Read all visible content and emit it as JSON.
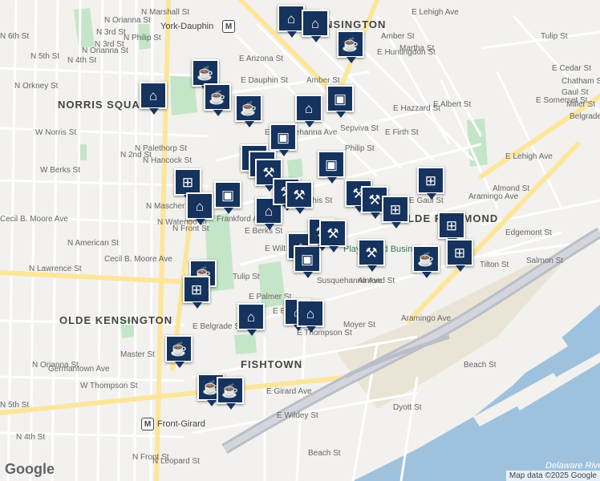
{
  "map": {
    "attribution": "Map data ©2025 Google",
    "logo": "Google",
    "river_label": "Delaware River",
    "colors": {
      "water": "#9ec2de",
      "park": "#c5e5c8",
      "road_major": "#fde69a",
      "highway": "#b9bec7",
      "land": "#f2f1ee",
      "marker": "#16335e"
    }
  },
  "neighborhoods": [
    {
      "name": "NORRIS SQUARE"
    },
    {
      "name": "OLDE KENSINGTON"
    },
    {
      "name": "FISHTOWN"
    },
    {
      "name": "OLDE RICHMOND"
    },
    {
      "name": "KENSINGTON"
    }
  ],
  "places": [
    {
      "name": "Playground Business"
    },
    {
      "name": "York-Dauphin"
    },
    {
      "name": "Front-Girard"
    }
  ],
  "streets": [
    "N 6th St",
    "N 5th St",
    "N 4th St",
    "N Orianna St",
    "N 3rd St",
    "N Philip St",
    "N 2nd St",
    "N Palethorp St",
    "N Hancock St",
    "N Orkney St",
    "W Norris St",
    "W Berks St",
    "Cecil B. Moore Ave",
    "Cecil B. Moore Ave",
    "N American St",
    "N Mascher St",
    "N Waterloo St",
    "N Front St",
    "Frankford Ave",
    "N Lawrence St",
    "N Orianna St",
    "Germantown Ave",
    "W Thompson St",
    "Master St",
    "N 5th St",
    "N 4th St",
    "N Front St",
    "N Leopard St",
    "E Girard Ave",
    "E Wildey St",
    "Beach St",
    "Dyott St",
    "Beach St",
    "Aramingo Ave",
    "Almond St",
    "Moyer St",
    "E Thompson St",
    "Tilton St",
    "Salmon St",
    "Edgemont St",
    "E Belgrade St",
    "E Eyre St",
    "Tulip St",
    "E Palmer St",
    "E Berks St",
    "E Wilt St",
    "Susquehanna Ave",
    "E Memphis St",
    "Sepviva St",
    "Philip St",
    "E Firth St",
    "E Hazzard St",
    "E Albert St",
    "E Huntingdon St",
    "Amber St",
    "Martha St",
    "E Lehigh Ave",
    "E Dauphin St",
    "E Arizona St",
    "Amber St",
    "Tulip St",
    "E Cedar St",
    "Chatham St",
    "Gaul St",
    "Miller St",
    "E Somerset St",
    "Belgrade St",
    "E Lehigh Ave",
    "Almond St",
    "Aramingo Ave",
    "E Gaul St",
    "E Susquehanna Ave",
    "N Orianna St",
    "N Marshall St",
    "N 3rd St"
  ],
  "markers": [
    {
      "icon": "graduation-cap-icon"
    },
    {
      "icon": "graduation-cap-icon"
    },
    {
      "icon": "coffee-icon"
    },
    {
      "icon": "coffee-icon"
    },
    {
      "icon": "graduation-cap-icon"
    },
    {
      "icon": "coffee-icon"
    },
    {
      "icon": "coffee-icon"
    },
    {
      "icon": "shopping-bag-icon"
    },
    {
      "icon": "graduation-cap-icon"
    },
    {
      "icon": "shopping-bag-icon"
    },
    {
      "icon": "restaurant-icon"
    },
    {
      "icon": "restaurant-icon"
    },
    {
      "icon": "restaurant-icon"
    },
    {
      "icon": "shopping-cart-icon"
    },
    {
      "icon": "graduation-cap-icon"
    },
    {
      "icon": "shopping-bag-icon"
    },
    {
      "icon": "shopping-bag-icon"
    },
    {
      "icon": "graduation-cap-icon"
    },
    {
      "icon": "shopping-cart-icon"
    },
    {
      "icon": "restaurant-icon"
    },
    {
      "icon": "restaurant-icon"
    },
    {
      "icon": "restaurant-icon"
    },
    {
      "icon": "restaurant-icon"
    },
    {
      "icon": "shopping-cart-icon"
    },
    {
      "icon": "graduation-cap-icon"
    },
    {
      "icon": "shopping-bag-icon"
    },
    {
      "icon": "shopping-cart-icon"
    },
    {
      "icon": "coffee-icon"
    },
    {
      "icon": "graduation-cap-icon"
    },
    {
      "icon": "restaurant-icon"
    },
    {
      "icon": "restaurant-icon"
    },
    {
      "icon": "coffee-icon"
    },
    {
      "icon": "graduation-cap-icon"
    },
    {
      "icon": "graduation-cap-icon"
    },
    {
      "icon": "coffee-icon"
    },
    {
      "icon": "coffee-icon"
    },
    {
      "icon": "coffee-icon"
    },
    {
      "icon": "shopping-cart-icon"
    },
    {
      "icon": "shopping-cart-icon"
    },
    {
      "icon": "restaurant-icon"
    }
  ]
}
